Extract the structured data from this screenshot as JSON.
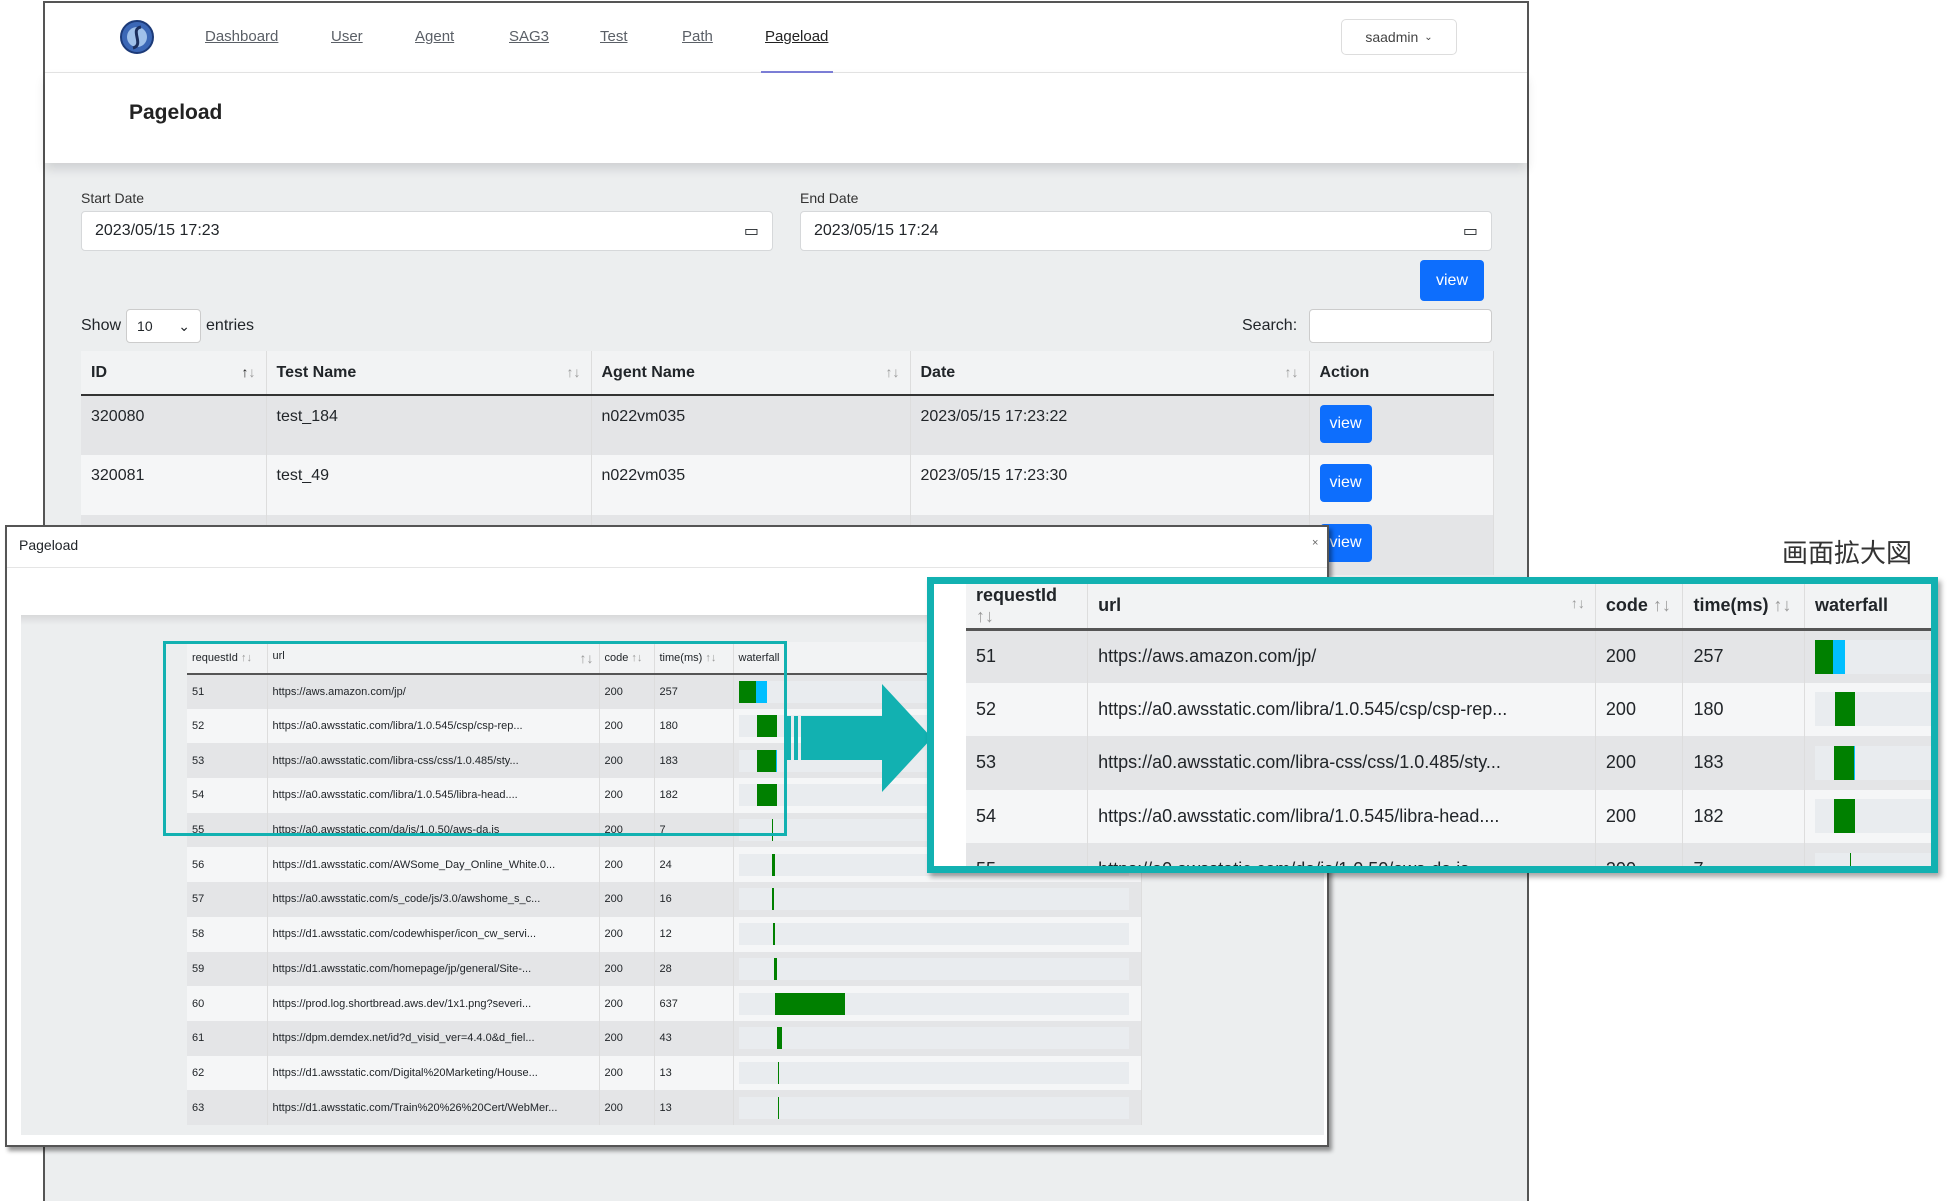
{
  "nav": {
    "items": [
      {
        "label": "Dashboard"
      },
      {
        "label": "User"
      },
      {
        "label": "Agent"
      },
      {
        "label": "SAG3"
      },
      {
        "label": "Test"
      },
      {
        "label": "Path"
      },
      {
        "label": "Pageload"
      }
    ],
    "active": "Pageload",
    "user": "saadmin"
  },
  "page": {
    "title": "Pageload"
  },
  "filters": {
    "start_label": "Start Date",
    "start_value": "2023/05/15 17:23",
    "end_label": "End Date",
    "end_value": "2023/05/15 17:24",
    "view_label": "view"
  },
  "table_controls": {
    "show": "Show",
    "entries_value": "10",
    "entries": "entries",
    "search_label": "Search:",
    "search_value": ""
  },
  "table": {
    "headers": [
      "ID",
      "Test Name",
      "Agent Name",
      "Date",
      "Action"
    ],
    "rows": [
      {
        "id": "320080",
        "test": "test_184",
        "agent": "n022vm035",
        "date": "2023/05/15 17:23:22",
        "action": "view"
      },
      {
        "id": "320081",
        "test": "test_49",
        "agent": "n022vm035",
        "date": "2023/05/15 17:23:30",
        "action": "view"
      },
      {
        "id": "",
        "test": "",
        "agent": "",
        "date": "",
        "action": "view"
      }
    ]
  },
  "modal": {
    "title": "Pageload",
    "close": "×",
    "headers": [
      "requestId",
      "url",
      "code",
      "time(ms)",
      "waterfall"
    ],
    "rows": [
      {
        "id": "51",
        "url": "https://aws.amazon.com/jp/",
        "code": "200",
        "time": "257",
        "wf_start_ms": 0,
        "wf_wait_ms": 160,
        "wf_recv_ms": 97
      },
      {
        "id": "52",
        "url": "https://a0.awsstatic.com/libra/1.0.545/csp/csp-rep...",
        "code": "200",
        "time": "180",
        "wf_start_ms": 170,
        "wf_wait_ms": 180,
        "wf_recv_ms": 0
      },
      {
        "id": "53",
        "url": "https://a0.awsstatic.com/libra-css/css/1.0.485/sty...",
        "code": "200",
        "time": "183",
        "wf_start_ms": 165,
        "wf_wait_ms": 175,
        "wf_recv_ms": 8
      },
      {
        "id": "54",
        "url": "https://a0.awsstatic.com/libra/1.0.545/libra-head....",
        "code": "200",
        "time": "182",
        "wf_start_ms": 165,
        "wf_wait_ms": 182,
        "wf_recv_ms": 0
      },
      {
        "id": "55",
        "url": "https://a0.awsstatic.com/da/js/1.0.50/aws-da.js",
        "code": "200",
        "time": "7",
        "wf_start_ms": 300,
        "wf_wait_ms": 7,
        "wf_recv_ms": 0
      },
      {
        "id": "56",
        "url": "https://d1.awsstatic.com/AWSome_Day_Online_White.0...",
        "code": "200",
        "time": "24",
        "wf_start_ms": 305,
        "wf_wait_ms": 24,
        "wf_recv_ms": 0
      },
      {
        "id": "57",
        "url": "https://a0.awsstatic.com/s_code/js/3.0/awshome_s_c...",
        "code": "200",
        "time": "16",
        "wf_start_ms": 305,
        "wf_wait_ms": 16,
        "wf_recv_ms": 0
      },
      {
        "id": "58",
        "url": "https://d1.awsstatic.com/codewhisper/icon_cw_servi...",
        "code": "200",
        "time": "12",
        "wf_start_ms": 315,
        "wf_wait_ms": 12,
        "wf_recv_ms": 0
      },
      {
        "id": "59",
        "url": "https://d1.awsstatic.com/homepage/jp/general/Site-...",
        "code": "200",
        "time": "28",
        "wf_start_ms": 320,
        "wf_wait_ms": 28,
        "wf_recv_ms": 0
      },
      {
        "id": "60",
        "url": "https://prod.log.shortbread.aws.dev/1x1.png?severi...",
        "code": "200",
        "time": "637",
        "wf_start_ms": 330,
        "wf_wait_ms": 637,
        "wf_recv_ms": 0
      },
      {
        "id": "61",
        "url": "https://dpm.demdex.net/id?d_visid_ver=4.4.0&d_fiel...",
        "code": "200",
        "time": "43",
        "wf_start_ms": 350,
        "wf_wait_ms": 43,
        "wf_recv_ms": 0
      },
      {
        "id": "62",
        "url": "https://d1.awsstatic.com/Digital%20Marketing/House...",
        "code": "200",
        "time": "13",
        "wf_start_ms": 355,
        "wf_wait_ms": 13,
        "wf_recv_ms": 0
      },
      {
        "id": "63",
        "url": "https://d1.awsstatic.com/Train%20%26%20Cert/WebMer...",
        "code": "200",
        "time": "13",
        "wf_start_ms": 355,
        "wf_wait_ms": 13,
        "wf_recv_ms": 0
      }
    ]
  },
  "zoom_caption": "画面拡大図",
  "colors": {
    "accent": "#0d6efd",
    "highlight": "#12b1b1",
    "wf_wait": "#008000",
    "wf_recv": "#00bfff"
  }
}
